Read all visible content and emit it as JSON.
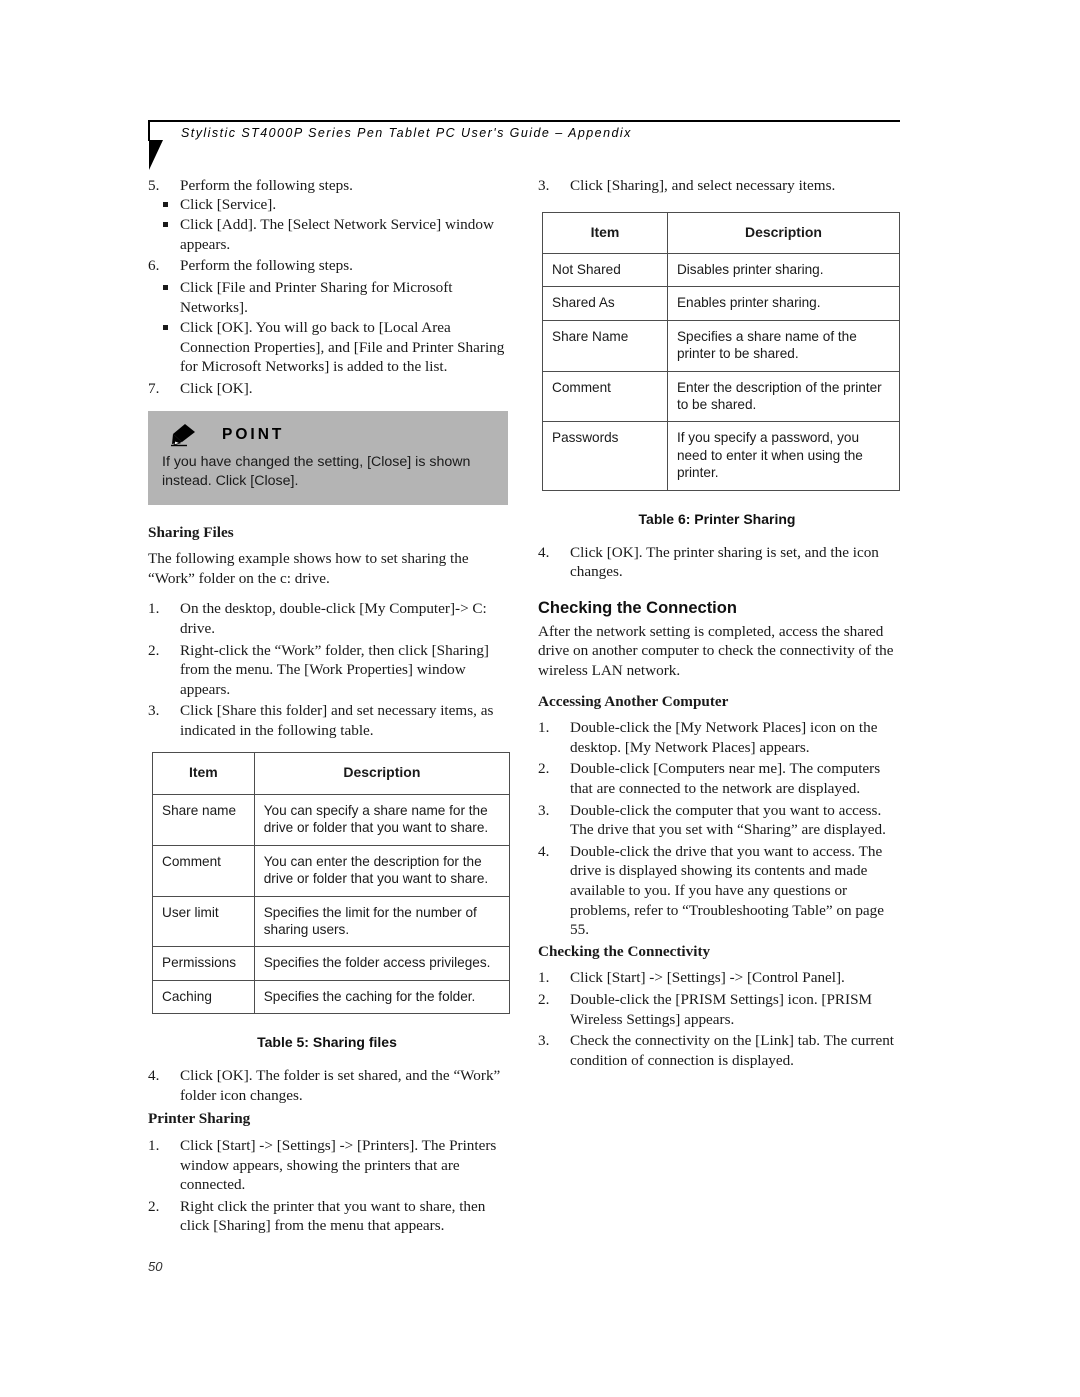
{
  "header": {
    "title": "Stylistic ST4000P Series Pen Tablet PC User's Guide – Appendix"
  },
  "footer": {
    "page_number": "50"
  },
  "left_column": {
    "step5": {
      "num": "5.",
      "text": "Perform the following steps.",
      "bullets": [
        "Click [Service].",
        "Click [Add]. The [Select Network Service] window appears."
      ]
    },
    "step6": {
      "num": "6.",
      "text": "Perform the following steps.",
      "bullets": [
        "Click [File and Printer Sharing for Microsoft Networks].",
        "Click [OK]. You will go back to [Local Area Connection Properties], and [File and Printer Sharing for Microsoft Networks] is added to the list."
      ]
    },
    "step7": {
      "num": "7.",
      "text": "Click [OK]."
    },
    "point_box": {
      "icon": "pen-icon",
      "title": "POINT",
      "body": "If you have changed the setting, [Close] is shown instead. Click [Close].",
      "background_color": "#b4b4b4"
    },
    "sharing_files": {
      "heading": "Sharing Files",
      "intro": "The following example shows how to set sharing the “Work” folder on the c: drive.",
      "steps": [
        {
          "num": "1.",
          "text": "On the desktop, double-click [My Computer]-> C: drive."
        },
        {
          "num": "2.",
          "text": "Right-click the “Work” folder, then click [Sharing] from the menu. The [Work Properties] window appears."
        },
        {
          "num": "3.",
          "text": "Click [Share this folder] and set necessary items, as indicated in the following table."
        }
      ]
    },
    "table5": {
      "headers": [
        "Item",
        "Description"
      ],
      "rows": [
        [
          "Share name",
          "You can specify a share name for the drive or folder that you want to share."
        ],
        [
          "Comment",
          "You can enter the description for the drive or folder that you want to share."
        ],
        [
          "User limit",
          "Specifies the limit for the number of sharing users."
        ],
        [
          "Permissions",
          "Specifies the folder access privileges."
        ],
        [
          "Caching",
          "Specifies the caching for the folder."
        ]
      ],
      "caption": "Table 5: Sharing files"
    },
    "after_table5": {
      "num": "4.",
      "text": "Click [OK]. The folder is set shared, and the “Work” folder icon changes."
    },
    "printer_sharing": {
      "heading": "Printer Sharing",
      "steps": [
        {
          "num": "1.",
          "text": "Click [Start] -> [Settings] -> [Printers]. The Printers window appears, showing the printers that are connected."
        },
        {
          "num": "2.",
          "text": "Right click the printer that you want to share, then click [Sharing] from the menu that appears."
        }
      ]
    }
  },
  "right_column": {
    "step3": {
      "num": "3.",
      "text": "Click [Sharing], and select necessary items."
    },
    "table6": {
      "headers": [
        "Item",
        "Description"
      ],
      "rows": [
        [
          "Not Shared",
          "Disables printer sharing."
        ],
        [
          "Shared As",
          "Enables printer sharing."
        ],
        [
          "Share Name",
          "Specifies a share name of the printer to be shared."
        ],
        [
          "Comment",
          "Enter the description of the printer to be shared."
        ],
        [
          "Passwords",
          "If you specify a password, you need to enter it when using the printer."
        ]
      ],
      "caption": "Table 6: Printer Sharing"
    },
    "after_table6": {
      "num": "4.",
      "text": "Click [OK]. The printer sharing is set, and the icon changes."
    },
    "checking_connection": {
      "heading": "Checking the Connection",
      "intro": "After the network setting is completed, access the shared drive on another computer to check the connectivity of the wireless LAN network."
    },
    "accessing_another_computer": {
      "heading": "Accessing Another Computer",
      "steps": [
        {
          "num": "1.",
          "text": "Double-click the [My Network Places] icon on the desktop. [My Network Places] appears."
        },
        {
          "num": "2.",
          "text": "Double-click [Computers near me]. The computers that are connected to the network are displayed."
        },
        {
          "num": "3.",
          "text": "Double-click the computer that you want to access. The drive that you set with “Sharing” are displayed."
        },
        {
          "num": "4.",
          "text": "Double-click the drive that you want to access. The drive is displayed showing its contents and made available to you. If you have any questions or problems, refer to “Troubleshooting Table” on page 55."
        }
      ]
    },
    "checking_connectivity": {
      "heading": "Checking the Connectivity",
      "steps": [
        {
          "num": "1.",
          "text": "Click [Start] -> [Settings] -> [Control Panel]."
        },
        {
          "num": "2.",
          "text": "Double-click the [PRISM Settings] icon. [PRISM Wireless Settings] appears."
        },
        {
          "num": "3.",
          "text": "Check the connectivity on the [Link] tab. The current condition of connection is displayed."
        }
      ]
    }
  }
}
